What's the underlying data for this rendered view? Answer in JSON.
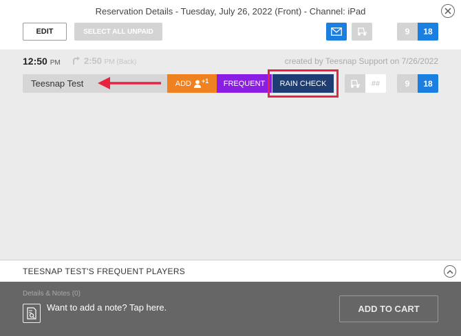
{
  "header": {
    "title": "Reservation Details - Tuesday, July 26, 2022 (Front) - Channel: iPad",
    "close_icon": "close-icon",
    "edit_label": "EDIT",
    "select_all_unpaid_label": "SELECT ALL UNPAID",
    "mail_icon": "mail-icon",
    "cart_icon": "golf-cart-icon",
    "holes": [
      "9",
      "18"
    ],
    "selected_holes": "18"
  },
  "reservation": {
    "time": "12:50",
    "time_ampm": "PM",
    "back_time": "2:50",
    "back_ampm": "PM (Back)",
    "created_by": "created by Teesnap Support on 7/26/2022"
  },
  "player_row": {
    "name": "Teesnap Test",
    "add_label": "ADD",
    "add_badge": "+1",
    "frequent_label": "FREQUENT",
    "rain_check_label": "RAIN CHECK",
    "cart_number_placeholder": "##",
    "holes": [
      "9",
      "18"
    ],
    "selected_holes": "18"
  },
  "frequent_players": {
    "title": "TEESNAP TEST'S FREQUENT PLAYERS"
  },
  "notes": {
    "label": "Details & Notes (0)",
    "prompt": "Want to add a note? Tap here."
  },
  "actions": {
    "add_to_cart_label": "ADD TO CART"
  },
  "colors": {
    "blue": "#1a7fe0",
    "orange": "#ef8121",
    "purple": "#8a1fe3",
    "navy": "#1e3e73",
    "highlight_red": "#e7233f"
  }
}
